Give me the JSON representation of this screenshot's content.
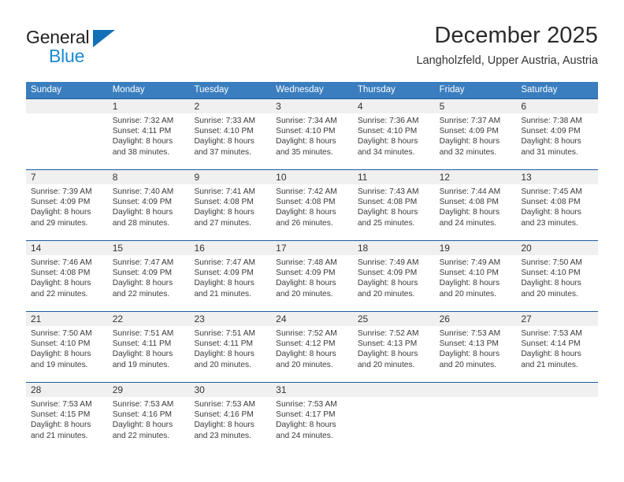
{
  "brand": {
    "name_part1": "General",
    "name_part2": "Blue",
    "accent_color": "#1a8ad4",
    "triangle_color": "#1170b8"
  },
  "header": {
    "title": "December 2025",
    "subtitle": "Langholzfeld, Upper Austria, Austria"
  },
  "theme": {
    "header_row_bg": "#3a7ebf",
    "week_divider": "#1c5c9e",
    "day_number_bg": "#f0f0f0"
  },
  "weekdays": [
    "Sunday",
    "Monday",
    "Tuesday",
    "Wednesday",
    "Thursday",
    "Friday",
    "Saturday"
  ],
  "labels": {
    "sunrise_prefix": "Sunrise:",
    "sunset_prefix": "Sunset:",
    "daylight_prefix": "Daylight:"
  },
  "weeks": [
    [
      {
        "day": "",
        "sunrise": "",
        "sunset": "",
        "daylight_line1": "",
        "daylight_line2": ""
      },
      {
        "day": "1",
        "sunrise": "Sunrise: 7:32 AM",
        "sunset": "Sunset: 4:11 PM",
        "daylight_line1": "Daylight: 8 hours",
        "daylight_line2": "and 38 minutes."
      },
      {
        "day": "2",
        "sunrise": "Sunrise: 7:33 AM",
        "sunset": "Sunset: 4:10 PM",
        "daylight_line1": "Daylight: 8 hours",
        "daylight_line2": "and 37 minutes."
      },
      {
        "day": "3",
        "sunrise": "Sunrise: 7:34 AM",
        "sunset": "Sunset: 4:10 PM",
        "daylight_line1": "Daylight: 8 hours",
        "daylight_line2": "and 35 minutes."
      },
      {
        "day": "4",
        "sunrise": "Sunrise: 7:36 AM",
        "sunset": "Sunset: 4:10 PM",
        "daylight_line1": "Daylight: 8 hours",
        "daylight_line2": "and 34 minutes."
      },
      {
        "day": "5",
        "sunrise": "Sunrise: 7:37 AM",
        "sunset": "Sunset: 4:09 PM",
        "daylight_line1": "Daylight: 8 hours",
        "daylight_line2": "and 32 minutes."
      },
      {
        "day": "6",
        "sunrise": "Sunrise: 7:38 AM",
        "sunset": "Sunset: 4:09 PM",
        "daylight_line1": "Daylight: 8 hours",
        "daylight_line2": "and 31 minutes."
      }
    ],
    [
      {
        "day": "7",
        "sunrise": "Sunrise: 7:39 AM",
        "sunset": "Sunset: 4:09 PM",
        "daylight_line1": "Daylight: 8 hours",
        "daylight_line2": "and 29 minutes."
      },
      {
        "day": "8",
        "sunrise": "Sunrise: 7:40 AM",
        "sunset": "Sunset: 4:09 PM",
        "daylight_line1": "Daylight: 8 hours",
        "daylight_line2": "and 28 minutes."
      },
      {
        "day": "9",
        "sunrise": "Sunrise: 7:41 AM",
        "sunset": "Sunset: 4:08 PM",
        "daylight_line1": "Daylight: 8 hours",
        "daylight_line2": "and 27 minutes."
      },
      {
        "day": "10",
        "sunrise": "Sunrise: 7:42 AM",
        "sunset": "Sunset: 4:08 PM",
        "daylight_line1": "Daylight: 8 hours",
        "daylight_line2": "and 26 minutes."
      },
      {
        "day": "11",
        "sunrise": "Sunrise: 7:43 AM",
        "sunset": "Sunset: 4:08 PM",
        "daylight_line1": "Daylight: 8 hours",
        "daylight_line2": "and 25 minutes."
      },
      {
        "day": "12",
        "sunrise": "Sunrise: 7:44 AM",
        "sunset": "Sunset: 4:08 PM",
        "daylight_line1": "Daylight: 8 hours",
        "daylight_line2": "and 24 minutes."
      },
      {
        "day": "13",
        "sunrise": "Sunrise: 7:45 AM",
        "sunset": "Sunset: 4:08 PM",
        "daylight_line1": "Daylight: 8 hours",
        "daylight_line2": "and 23 minutes."
      }
    ],
    [
      {
        "day": "14",
        "sunrise": "Sunrise: 7:46 AM",
        "sunset": "Sunset: 4:08 PM",
        "daylight_line1": "Daylight: 8 hours",
        "daylight_line2": "and 22 minutes."
      },
      {
        "day": "15",
        "sunrise": "Sunrise: 7:47 AM",
        "sunset": "Sunset: 4:09 PM",
        "daylight_line1": "Daylight: 8 hours",
        "daylight_line2": "and 22 minutes."
      },
      {
        "day": "16",
        "sunrise": "Sunrise: 7:47 AM",
        "sunset": "Sunset: 4:09 PM",
        "daylight_line1": "Daylight: 8 hours",
        "daylight_line2": "and 21 minutes."
      },
      {
        "day": "17",
        "sunrise": "Sunrise: 7:48 AM",
        "sunset": "Sunset: 4:09 PM",
        "daylight_line1": "Daylight: 8 hours",
        "daylight_line2": "and 20 minutes."
      },
      {
        "day": "18",
        "sunrise": "Sunrise: 7:49 AM",
        "sunset": "Sunset: 4:09 PM",
        "daylight_line1": "Daylight: 8 hours",
        "daylight_line2": "and 20 minutes."
      },
      {
        "day": "19",
        "sunrise": "Sunrise: 7:49 AM",
        "sunset": "Sunset: 4:10 PM",
        "daylight_line1": "Daylight: 8 hours",
        "daylight_line2": "and 20 minutes."
      },
      {
        "day": "20",
        "sunrise": "Sunrise: 7:50 AM",
        "sunset": "Sunset: 4:10 PM",
        "daylight_line1": "Daylight: 8 hours",
        "daylight_line2": "and 20 minutes."
      }
    ],
    [
      {
        "day": "21",
        "sunrise": "Sunrise: 7:50 AM",
        "sunset": "Sunset: 4:10 PM",
        "daylight_line1": "Daylight: 8 hours",
        "daylight_line2": "and 19 minutes."
      },
      {
        "day": "22",
        "sunrise": "Sunrise: 7:51 AM",
        "sunset": "Sunset: 4:11 PM",
        "daylight_line1": "Daylight: 8 hours",
        "daylight_line2": "and 19 minutes."
      },
      {
        "day": "23",
        "sunrise": "Sunrise: 7:51 AM",
        "sunset": "Sunset: 4:11 PM",
        "daylight_line1": "Daylight: 8 hours",
        "daylight_line2": "and 20 minutes."
      },
      {
        "day": "24",
        "sunrise": "Sunrise: 7:52 AM",
        "sunset": "Sunset: 4:12 PM",
        "daylight_line1": "Daylight: 8 hours",
        "daylight_line2": "and 20 minutes."
      },
      {
        "day": "25",
        "sunrise": "Sunrise: 7:52 AM",
        "sunset": "Sunset: 4:13 PM",
        "daylight_line1": "Daylight: 8 hours",
        "daylight_line2": "and 20 minutes."
      },
      {
        "day": "26",
        "sunrise": "Sunrise: 7:53 AM",
        "sunset": "Sunset: 4:13 PM",
        "daylight_line1": "Daylight: 8 hours",
        "daylight_line2": "and 20 minutes."
      },
      {
        "day": "27",
        "sunrise": "Sunrise: 7:53 AM",
        "sunset": "Sunset: 4:14 PM",
        "daylight_line1": "Daylight: 8 hours",
        "daylight_line2": "and 21 minutes."
      }
    ],
    [
      {
        "day": "28",
        "sunrise": "Sunrise: 7:53 AM",
        "sunset": "Sunset: 4:15 PM",
        "daylight_line1": "Daylight: 8 hours",
        "daylight_line2": "and 21 minutes."
      },
      {
        "day": "29",
        "sunrise": "Sunrise: 7:53 AM",
        "sunset": "Sunset: 4:16 PM",
        "daylight_line1": "Daylight: 8 hours",
        "daylight_line2": "and 22 minutes."
      },
      {
        "day": "30",
        "sunrise": "Sunrise: 7:53 AM",
        "sunset": "Sunset: 4:16 PM",
        "daylight_line1": "Daylight: 8 hours",
        "daylight_line2": "and 23 minutes."
      },
      {
        "day": "31",
        "sunrise": "Sunrise: 7:53 AM",
        "sunset": "Sunset: 4:17 PM",
        "daylight_line1": "Daylight: 8 hours",
        "daylight_line2": "and 24 minutes."
      },
      {
        "day": "",
        "sunrise": "",
        "sunset": "",
        "daylight_line1": "",
        "daylight_line2": ""
      },
      {
        "day": "",
        "sunrise": "",
        "sunset": "",
        "daylight_line1": "",
        "daylight_line2": ""
      },
      {
        "day": "",
        "sunrise": "",
        "sunset": "",
        "daylight_line1": "",
        "daylight_line2": ""
      }
    ]
  ]
}
